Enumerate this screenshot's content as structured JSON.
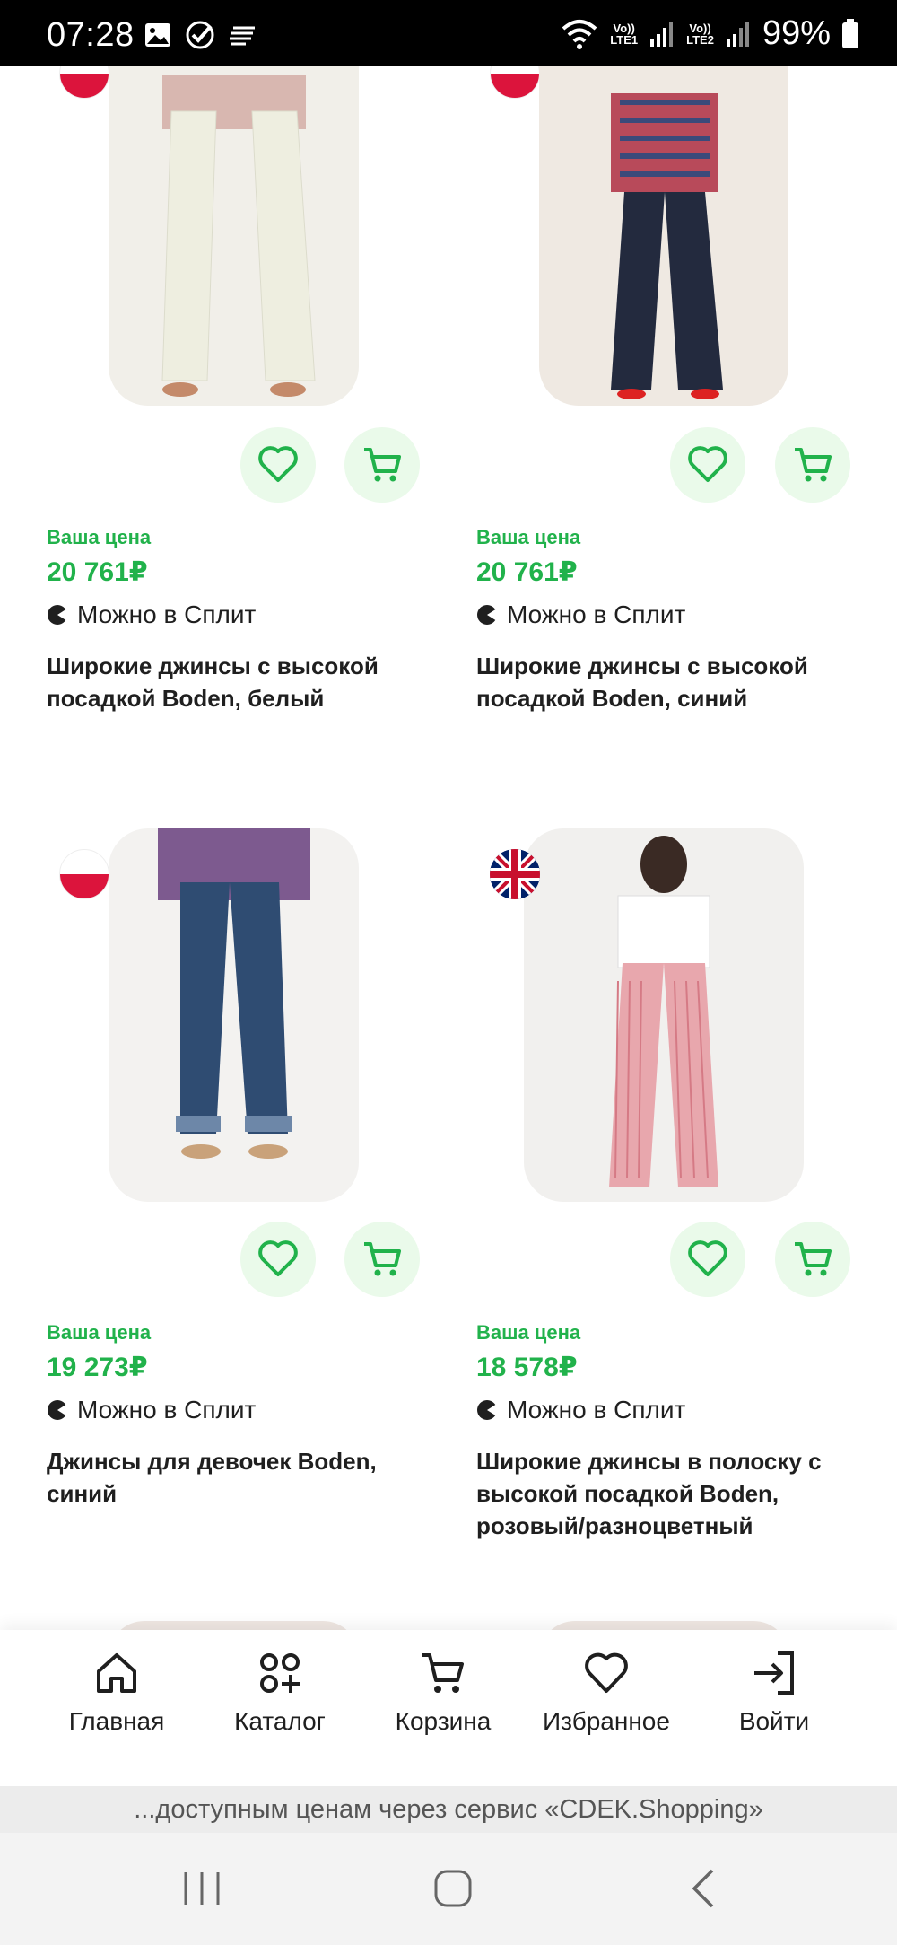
{
  "status_bar": {
    "time": "07:28",
    "battery": "99%",
    "sim1": "LTE1",
    "sim2": "LTE2",
    "vo": "Vo))"
  },
  "products": [
    {
      "price_label": "Ваша цена",
      "price": "20 761₽",
      "split": "Можно в Сплит",
      "title": "Широкие джинсы с высокой посадкой Boden, белый",
      "flag": "poland-flag-icon"
    },
    {
      "price_label": "Ваша цена",
      "price": "20 761₽",
      "split": "Можно в Сплит",
      "title": "Широкие джинсы с высокой посадкой Boden, синий",
      "flag": "poland-flag-icon"
    },
    {
      "price_label": "Ваша цена",
      "price": "19 273₽",
      "split": "Можно в Сплит",
      "title": "Джинсы для девочек Boden, синий",
      "flag": "poland-flag-icon"
    },
    {
      "price_label": "Ваша цена",
      "price": "18 578₽",
      "split": "Можно в Сплит",
      "title": "Широкие джинсы в полоску с высокой посадкой Boden, розовый/разноцветный",
      "flag": "uk-flag-icon"
    }
  ],
  "bottom_nav": [
    {
      "label": "Главная",
      "icon": "home-icon"
    },
    {
      "label": "Каталог",
      "icon": "catalog-icon"
    },
    {
      "label": "Корзина",
      "icon": "cart-icon"
    },
    {
      "label": "Избранное",
      "icon": "heart-icon"
    },
    {
      "label": "Войти",
      "icon": "login-icon"
    }
  ],
  "banner": "...доступным ценам через сервис «CDEK.Shopping»",
  "colors": {
    "accent_green": "#21b24b",
    "button_bg": "#eafaea"
  }
}
